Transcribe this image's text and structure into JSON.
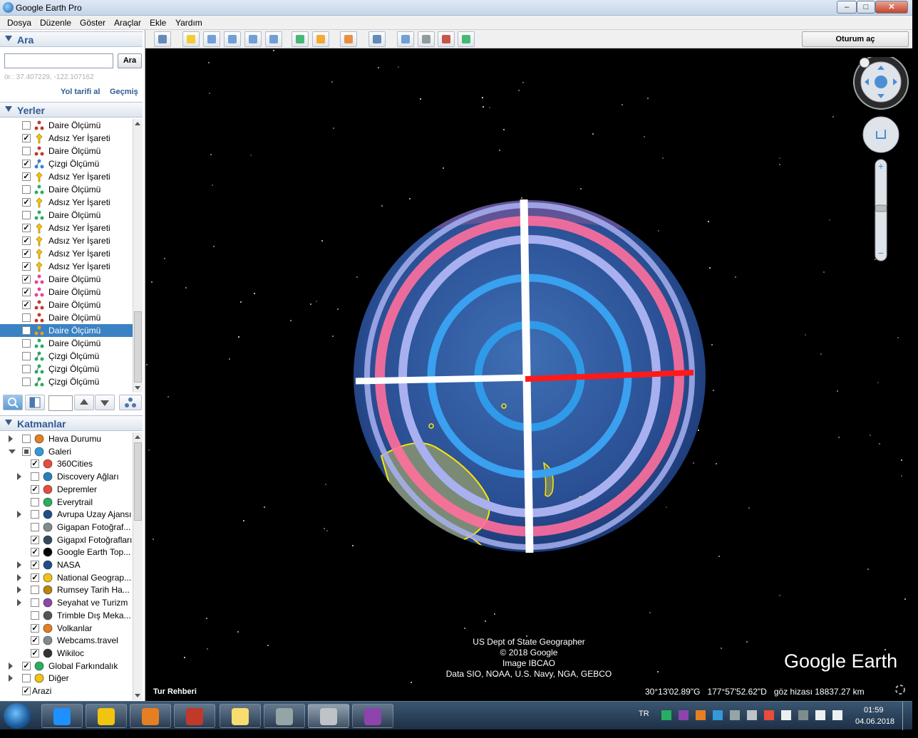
{
  "window": {
    "title": "Google Earth Pro",
    "min": "‒",
    "max": "□",
    "close": "✕"
  },
  "menu": [
    "Dosya",
    "Düzenle",
    "Göster",
    "Araçlar",
    "Ekle",
    "Yardım"
  ],
  "search": {
    "header": "Ara",
    "input_value": "",
    "button": "Ara",
    "hint": "ör.: 37.407229, -122.107162",
    "directions_link": "Yol tarifi al",
    "history_link": "Geçmiş"
  },
  "places": {
    "header": "Yerler",
    "items": [
      {
        "label": "Daire Ölçümü",
        "checked": false,
        "icon": "circle-measure-icon",
        "color": "#c0392b"
      },
      {
        "label": "Adsız Yer İşareti",
        "checked": true,
        "icon": "placemark-pin-icon",
        "color": "#f1c40f"
      },
      {
        "label": "Daire Ölçümü",
        "checked": false,
        "icon": "circle-measure-icon",
        "color": "#c0392b"
      },
      {
        "label": "Çizgi Ölçümü",
        "checked": true,
        "icon": "line-measure-icon",
        "color": "#2e86de"
      },
      {
        "label": "Adsız Yer İşareti",
        "checked": true,
        "icon": "placemark-pin-icon",
        "color": "#f1c40f"
      },
      {
        "label": "Daire Ölçümü",
        "checked": false,
        "icon": "circle-measure-icon",
        "color": "#27ae60"
      },
      {
        "label": "Adsız Yer İşareti",
        "checked": true,
        "icon": "placemark-pin-icon",
        "color": "#f1c40f"
      },
      {
        "label": "Daire Ölçümü",
        "checked": false,
        "icon": "circle-measure-icon",
        "color": "#27ae60"
      },
      {
        "label": "Adsız Yer İşareti",
        "checked": true,
        "icon": "placemark-pin-icon",
        "color": "#f1c40f"
      },
      {
        "label": "Adsız Yer İşareti",
        "checked": true,
        "icon": "placemark-pin-icon",
        "color": "#f1c40f"
      },
      {
        "label": "Adsız Yer İşareti",
        "checked": true,
        "icon": "placemark-pin-icon",
        "color": "#f1c40f"
      },
      {
        "label": "Adsız Yer İşareti",
        "checked": true,
        "icon": "placemark-pin-icon",
        "color": "#f1c40f"
      },
      {
        "label": "Daire Ölçümü",
        "checked": true,
        "icon": "circle-measure-icon",
        "color": "#e84393"
      },
      {
        "label": "Daire Ölçümü",
        "checked": true,
        "icon": "circle-measure-icon",
        "color": "#e84393"
      },
      {
        "label": "Daire Ölçümü",
        "checked": true,
        "icon": "circle-measure-icon",
        "color": "#c0392b"
      },
      {
        "label": "Daire Ölçümü",
        "checked": false,
        "icon": "circle-measure-icon",
        "color": "#c0392b"
      },
      {
        "label": "Daire Ölçümü",
        "checked": false,
        "icon": "circle-measure-icon",
        "color": "#f39c12",
        "selected": true
      },
      {
        "label": "Daire Ölçümü",
        "checked": false,
        "icon": "circle-measure-icon",
        "color": "#27ae60"
      },
      {
        "label": "Çizgi Ölçümü",
        "checked": false,
        "icon": "line-measure-icon",
        "color": "#27ae60"
      },
      {
        "label": "Çizgi Ölçümü",
        "checked": false,
        "icon": "line-measure-icon",
        "color": "#27ae60"
      },
      {
        "label": "Çizgi Ölçümü",
        "checked": false,
        "icon": "line-measure-icon",
        "color": "#27ae60"
      }
    ]
  },
  "layers": {
    "header": "Katmanlar",
    "items": [
      {
        "label": "Hava Durumu",
        "checked": false,
        "expander": "closed",
        "level": 0,
        "icon": "weather-sun-icon",
        "color": "#e67e22"
      },
      {
        "label": "Galeri",
        "checked": "partial",
        "expander": "open",
        "level": 0,
        "icon": "gallery-star-icon",
        "color": "#3498db"
      },
      {
        "label": "360Cities",
        "checked": true,
        "expander": "none",
        "level": 1,
        "icon": "360cities-icon",
        "color": "#e74c3c"
      },
      {
        "label": "Discovery Ağları",
        "checked": false,
        "expander": "closed",
        "level": 1,
        "icon": "discovery-icon",
        "color": "#2980b9"
      },
      {
        "label": "Depremler",
        "checked": true,
        "expander": "none",
        "level": 1,
        "icon": "earthquake-icon",
        "color": "#e74c3c"
      },
      {
        "label": "Everytrail",
        "checked": false,
        "expander": "none",
        "level": 1,
        "icon": "everytrail-icon",
        "color": "#27ae60"
      },
      {
        "label": "Avrupa Uzay Ajansı",
        "checked": false,
        "expander": "closed",
        "level": 1,
        "icon": "esa-icon",
        "color": "#1f4e8c"
      },
      {
        "label": "Gigapan Fotoğraf...",
        "checked": false,
        "expander": "none",
        "level": 1,
        "icon": "magnifier-icon",
        "color": "#7f8c8d"
      },
      {
        "label": "Gigapxl Fotoğrafları",
        "checked": true,
        "expander": "none",
        "level": 1,
        "icon": "camera-icon",
        "color": "#34495e"
      },
      {
        "label": "Google Earth Top...",
        "checked": true,
        "expander": "none",
        "level": 1,
        "icon": "info-icon",
        "color": "#000000"
      },
      {
        "label": "NASA",
        "checked": true,
        "expander": "closed",
        "level": 1,
        "icon": "nasa-icon",
        "color": "#1f4e8c"
      },
      {
        "label": "National Geograp...",
        "checked": true,
        "expander": "closed",
        "level": 1,
        "icon": "natgeo-icon",
        "color": "#f1c40f"
      },
      {
        "label": "Rumsey Tarih Ha...",
        "checked": false,
        "expander": "closed",
        "level": 1,
        "icon": "compass-rose-icon",
        "color": "#b8860b"
      },
      {
        "label": "Seyahat ve Turizm",
        "checked": false,
        "expander": "closed",
        "level": 1,
        "icon": "travel-icon",
        "color": "#8e44ad"
      },
      {
        "label": "Trimble Dış Meka...",
        "checked": false,
        "expander": "none",
        "level": 1,
        "icon": "trimble-icon",
        "color": "#555555"
      },
      {
        "label": "Volkanlar",
        "checked": true,
        "expander": "none",
        "level": 1,
        "icon": "volcano-icon",
        "color": "#e67e22"
      },
      {
        "label": "Webcams.travel",
        "checked": true,
        "expander": "none",
        "level": 1,
        "icon": "webcam-icon",
        "color": "#7f8c8d"
      },
      {
        "label": "Wikiloc",
        "checked": true,
        "expander": "none",
        "level": 1,
        "icon": "wikiloc-icon",
        "color": "#333333"
      },
      {
        "label": "Global Farkındalık",
        "checked": true,
        "expander": "closed",
        "level": 0,
        "icon": "globe-icon",
        "color": "#27ae60"
      },
      {
        "label": "Diğer",
        "checked": false,
        "expander": "closed",
        "level": 0,
        "icon": "folder-icon",
        "color": "#f1c40f"
      },
      {
        "label": "Arazi",
        "checked": true,
        "expander": "none",
        "level": 0,
        "icon": "",
        "color": ""
      }
    ]
  },
  "toolbar": {
    "buttons": [
      "sidebar-toggle-icon",
      "add-placemark-icon",
      "add-polygon-icon",
      "add-path-icon",
      "add-image-overlay-icon",
      "record-tour-icon",
      "historical-imagery-icon",
      "sunlight-icon",
      "switch-planet-icon",
      "ruler-icon",
      "email-icon",
      "print-icon",
      "save-image-icon",
      "view-in-maps-icon"
    ],
    "signin": "Oturum aç"
  },
  "viewport": {
    "attribution": [
      "US Dept of State Geographer",
      "© 2018 Google",
      "Image IBCAO",
      "Data SIO, NOAA, U.S. Navy, NGA, GEBCO"
    ],
    "logo": "Google Earth",
    "tour_guide": "Tur Rehberi",
    "status": {
      "lat": "30°13'02.89\"G",
      "lon": "177°57'52.62\"D",
      "eye_alt": "göz hizası 18837.27 km"
    }
  },
  "taskbar": {
    "lang": "TR",
    "time": "01:59",
    "date": "04.06.2018",
    "apps": [
      "ie-icon",
      "explorer-folder-icon",
      "media-player-icon",
      "snipping-tool-icon",
      "sticky-notes-icon",
      "calculator-icon",
      "google-earth-pro-icon",
      "paint-icon"
    ],
    "active_app": 6
  },
  "colors": {
    "accent": "#2f5a94",
    "selection": "#3a82c4",
    "ring_pink": "#ff6f9c",
    "ring_lavender": "#a8b0f0",
    "ring_blue": "#2f9be8",
    "measure_red": "#ff1a1a"
  }
}
